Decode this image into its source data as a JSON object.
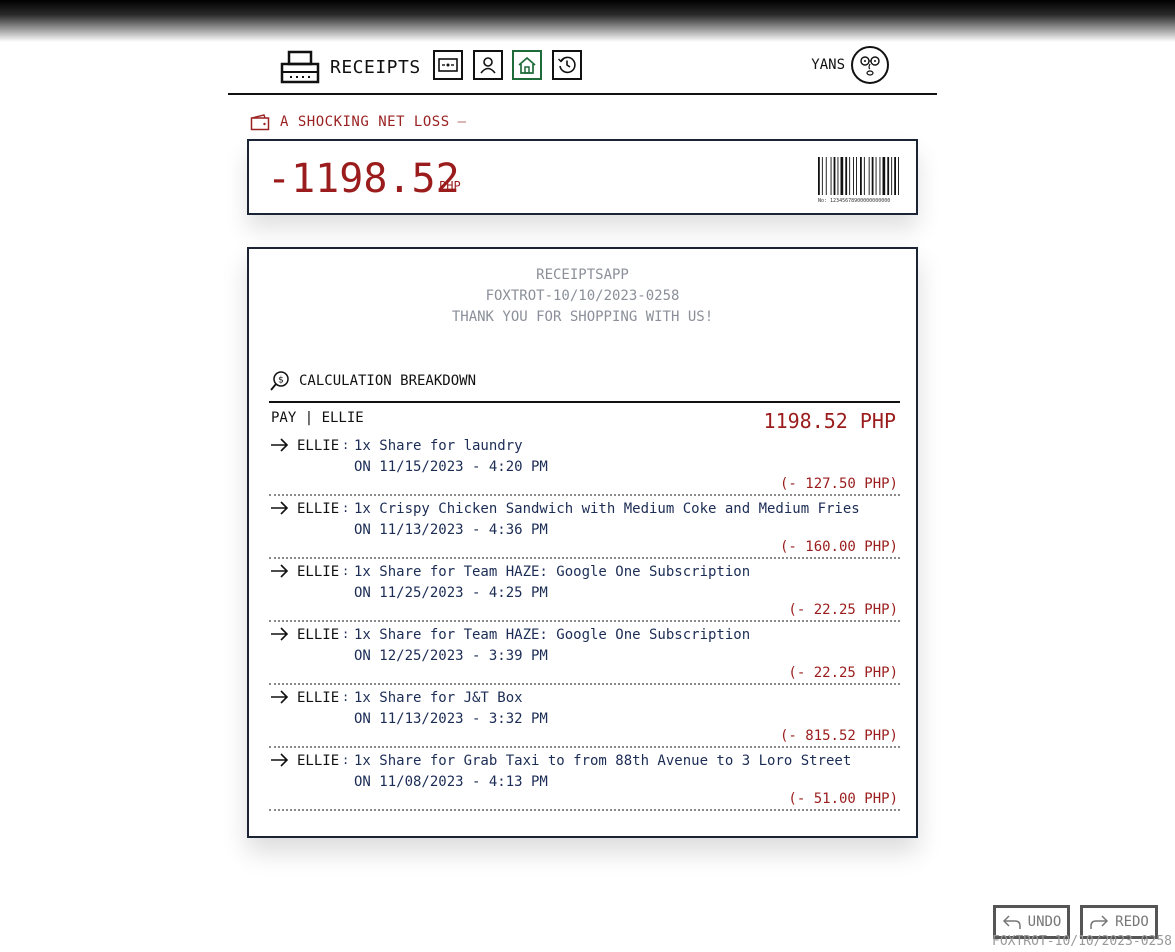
{
  "nav": {
    "title": "RECEIPTS",
    "buttons": [
      {
        "name": "wallet-icon"
      },
      {
        "name": "user-icon"
      },
      {
        "name": "home-icon",
        "active": true
      },
      {
        "name": "history-icon"
      }
    ],
    "user_name": "YANS"
  },
  "status": {
    "text": "A SHOCKING NET LOSS",
    "dash": "—"
  },
  "balance": {
    "amount": "-1198.52",
    "unit": "PHP",
    "barcode_caption": "No: 12345678900000000000"
  },
  "receipt": {
    "app_name": "RECEIPTSAPP",
    "receipt_id": "FOXTROT-10/10/2023-0258",
    "thanks": "THANK YOU FOR SHOPPING WITH US!",
    "section_title": "CALCULATION BREAKDOWN",
    "pay_label": "PAY | ELLIE",
    "pay_total": "1198.52 PHP",
    "items": [
      {
        "who": "ELLIE",
        "desc": "1x Share for laundry",
        "date": "ON 11/15/2023 - 4:20 PM",
        "amount": "(- 127.50 PHP)"
      },
      {
        "who": "ELLIE",
        "desc": "1x Crispy Chicken Sandwich with Medium Coke and Medium Fries",
        "date": "ON 11/13/2023 - 4:36 PM",
        "amount": "(- 160.00 PHP)"
      },
      {
        "who": "ELLIE",
        "desc": "1x Share for Team HAZE: Google One Subscription",
        "date": "ON 11/25/2023 - 4:25 PM",
        "amount": "(- 22.25 PHP)"
      },
      {
        "who": "ELLIE",
        "desc": "1x Share for Team HAZE: Google One Subscription",
        "date": "ON 12/25/2023 - 3:39 PM",
        "amount": "(- 22.25 PHP)"
      },
      {
        "who": "ELLIE",
        "desc": "1x Share for J&T Box",
        "date": "ON 11/13/2023 - 3:32 PM",
        "amount": "(- 815.52 PHP)"
      },
      {
        "who": "ELLIE",
        "desc": "1x Share for Grab Taxi to from 88th Avenue to 3 Loro Street",
        "date": "ON 11/08/2023 - 4:13 PM",
        "amount": "(- 51.00 PHP)"
      }
    ]
  },
  "controls": {
    "undo": "UNDO",
    "redo": "REDO",
    "footer_id": "FOXTROT-10/10/2023-0258"
  },
  "colors": {
    "loss": "#9b1c1c",
    "active": "#1e6b39",
    "ink": "#1b2c55"
  }
}
